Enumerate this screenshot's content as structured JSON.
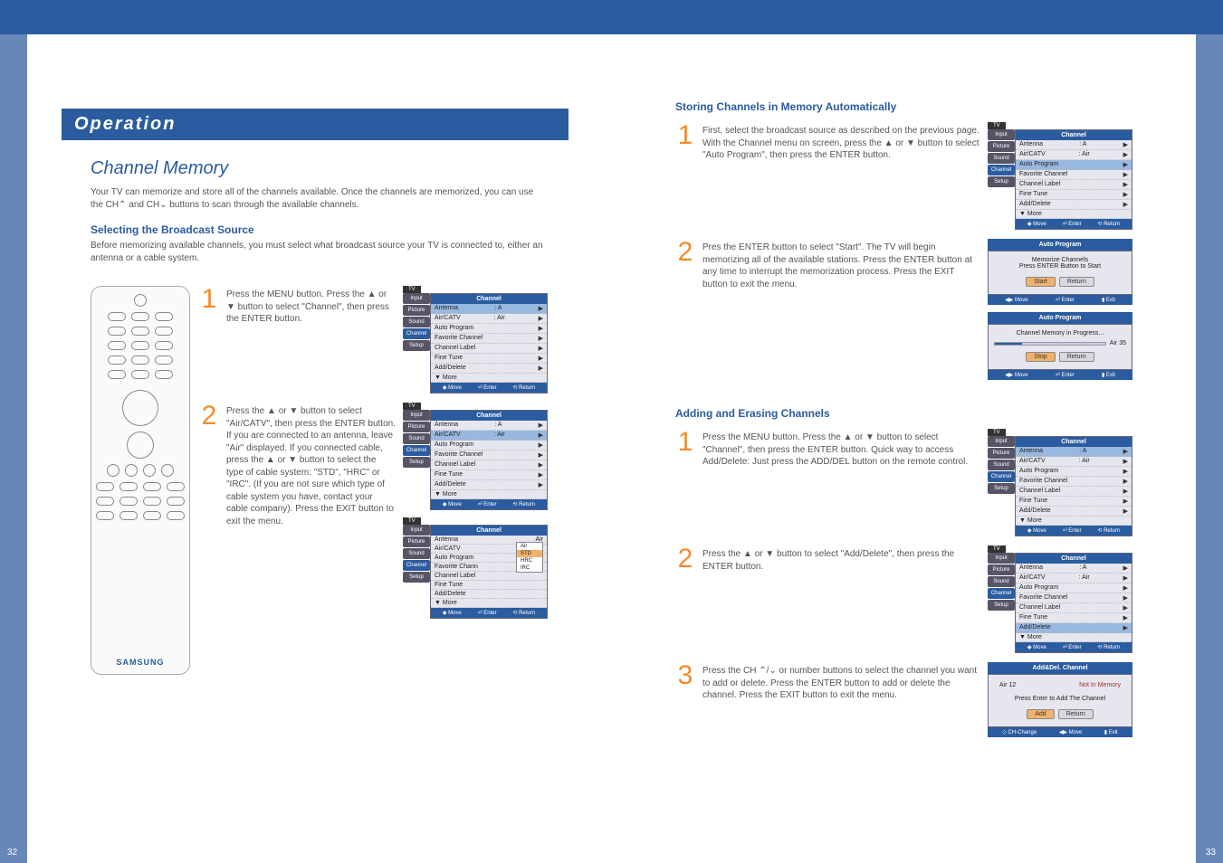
{
  "header": {
    "operation": "Operation"
  },
  "left": {
    "title": "Channel Memory",
    "intro": "Your TV can memorize and store all of the channels available. Once the channels are memorized, you can use the CH⌃ and CH⌄ buttons to scan through the available channels.",
    "h_select_source": "Selecting the Broadcast Source",
    "select_source_intro": "Before memorizing available channels, you must select what broadcast source your TV is connected to, either an antenna or a cable system.",
    "step1": "Press the MENU button. Press the ▲ or ▼ button to select \"Channel\", then press the ENTER button.",
    "step2": "Press the ▲ or ▼ button to select \"Air/CATV\", then press the ENTER button. If you are connected to an antenna, leave \"Air\" displayed. If you connected cable, press the ▲ or ▼ button to select the type of cable system: \"STD\", \"HRC\" or \"IRC\". (If you are not sure which type of cable system you have, contact your cable company). Press the EXIT button to exit the menu.",
    "remote_brand": "SAMSUNG",
    "page_num": "32"
  },
  "right": {
    "h_auto": "Storing Channels in Memory Automatically",
    "auto_step1": "First, select the broadcast source as described on the previous page. With the Channel menu on screen, press the ▲ or ▼ button to select \"Auto Program\", then press the ENTER button.",
    "auto_step2": "Pres the ENTER button to select \"Start\". The TV will begin memorizing all of the available stations. Press the ENTER button at any time to interrupt the memorization process. Press the EXIT button to exit the menu.",
    "h_adderase": "Adding and Erasing Channels",
    "ae_step1": "Press the MENU button. Press the ▲ or ▼ button to select \"Channel\", then press the ENTER button. Quick way to access Add/Delete: Just press the ADD/DEL button on the remote control.",
    "ae_step2": "Press the ▲ or ▼ button to select \"Add/Delete\", then press the ENTER button.",
    "ae_step3": "Press the CH ⌃/⌄ or number buttons to select the channel you want to add or delete. Press the ENTER button to add or delete the channel. Press the EXIT button to exit the menu.",
    "page_num": "33"
  },
  "osd": {
    "tv": "TV",
    "channel": "Channel",
    "side_tabs": [
      "Input",
      "Picture",
      "Sound",
      "Channel",
      "Setup"
    ],
    "items_basic": [
      {
        "l": "Antenna",
        "r": ": A"
      },
      {
        "l": "Air/CATV",
        "r": ": Air"
      },
      {
        "l": "Auto Program",
        "r": ""
      },
      {
        "l": "Favorite Channel",
        "r": ""
      },
      {
        "l": "Channel Label",
        "r": ""
      },
      {
        "l": "Fine Tune",
        "r": ""
      },
      {
        "l": "Add/Delete",
        "r": ""
      },
      {
        "l": "▼ More",
        "r": ""
      }
    ],
    "footer": {
      "move": "Move",
      "enter": "Enter",
      "return": "Return",
      "exit": "Exit",
      "ch": "CH-Change"
    },
    "catv_opts": [
      "Air",
      "STD",
      "HRC",
      "IRC"
    ],
    "auto_program": {
      "title": "Auto Program",
      "memorize": "Memorize Channels",
      "press_enter": "Press ENTER Button to Start",
      "start": "Start",
      "return": "Return",
      "progress": "Channel Memory in Progress...",
      "channel": "Air 35",
      "stop": "Stop"
    },
    "adddel": {
      "title": "Add&Del. Channel",
      "ch": "Air 12",
      "status": "Not In Memory",
      "prompt": "Press Enter to Add The Channel",
      "add": "Add",
      "return": "Return"
    }
  }
}
